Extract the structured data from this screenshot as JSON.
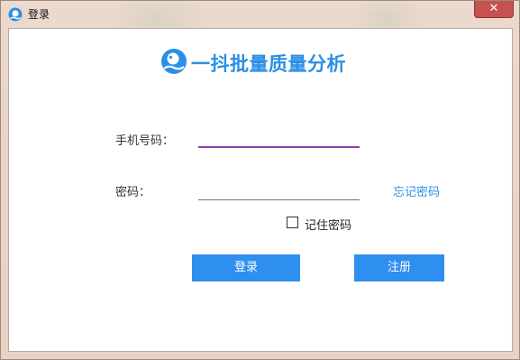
{
  "window": {
    "title": "登录",
    "close_label": "✕"
  },
  "brand": {
    "name": "一抖批量质量分析",
    "color": "#2a8fe6"
  },
  "form": {
    "phone_label": "手机号码：",
    "phone_value": "",
    "password_label": "密码：",
    "password_value": "",
    "forgot_link": "忘记密码",
    "remember_label": "记住密码",
    "remember_checked": false
  },
  "buttons": {
    "login": "登录",
    "register": "注册"
  },
  "colors": {
    "primary_button": "#2e8ff0",
    "active_input_underline": "#8a3fb0"
  }
}
